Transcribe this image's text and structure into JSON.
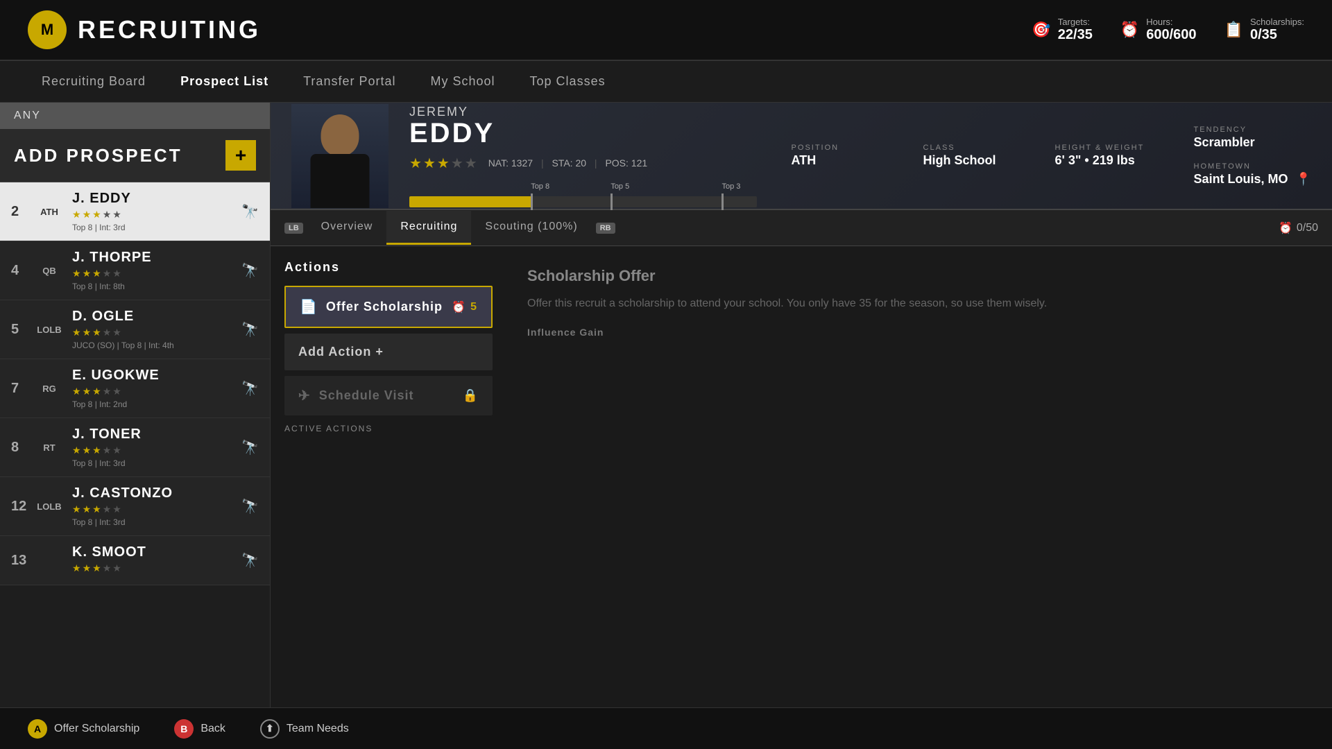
{
  "header": {
    "logo_text": "M",
    "title": "RECRUITING",
    "stats": {
      "targets_label": "Targets:",
      "targets_value": "22/35",
      "hours_label": "Hours:",
      "hours_value": "600/600",
      "scholarships_label": "Scholarships:",
      "scholarships_value": "0/35"
    }
  },
  "nav": {
    "items": [
      {
        "label": "Recruiting Board",
        "id": "recruiting-board",
        "active": false
      },
      {
        "label": "Prospect List",
        "id": "prospect-list",
        "active": true
      },
      {
        "label": "Transfer Portal",
        "id": "transfer-portal",
        "active": false
      },
      {
        "label": "My School",
        "id": "my-school",
        "active": false
      },
      {
        "label": "Top Classes",
        "id": "top-classes",
        "active": false
      }
    ]
  },
  "left_panel": {
    "filter_value": "ANY",
    "add_prospect_label": "ADD PROSPECT",
    "add_plus": "+",
    "prospects": [
      {
        "rank": "2",
        "pos": "ATH",
        "name": "J. EDDY",
        "stars": 3,
        "total_stars": 5,
        "sub": "Top 8 | Int: 3rd",
        "selected": true
      },
      {
        "rank": "4",
        "pos": "QB",
        "name": "J. THORPE",
        "stars": 3,
        "total_stars": 5,
        "sub": "Top 8 | Int: 8th",
        "selected": false
      },
      {
        "rank": "5",
        "pos": "LOLB",
        "name": "D. OGLE",
        "stars": 3,
        "total_stars": 5,
        "sub": "JUCO (SO) | Top 8 | Int: 4th",
        "selected": false
      },
      {
        "rank": "7",
        "pos": "RG",
        "name": "E. UGOKWE",
        "stars": 3,
        "total_stars": 5,
        "sub": "Top 8 | Int: 2nd",
        "selected": false
      },
      {
        "rank": "8",
        "pos": "RT",
        "name": "J. TONER",
        "stars": 3,
        "total_stars": 5,
        "sub": "Top 8 | Int: 3rd",
        "selected": false
      },
      {
        "rank": "12",
        "pos": "LOLB",
        "name": "J. CASTONZO",
        "stars": 3,
        "total_stars": 5,
        "sub": "Top 8 | Int: 3rd",
        "selected": false
      },
      {
        "rank": "13",
        "pos": "",
        "name": "K. SMOOT",
        "stars": 3,
        "total_stars": 5,
        "sub": "",
        "selected": false
      }
    ]
  },
  "player": {
    "first_name": "JEREMY",
    "last_name": "EDDY",
    "stars": 3,
    "total_stars": 5,
    "nat": "1327",
    "sta": "20",
    "pos_rank": "121",
    "position": "ATH",
    "class": "High School",
    "height_weight": "6' 3\" • 219 lbs",
    "tendency": "Scrambler",
    "hometown": "Saint Louis, MO",
    "progress_fill_pct": 35,
    "top8_pct": 35,
    "top5_pct": 58,
    "top3_pct": 90,
    "top8_label": "Top 8",
    "top5_label": "Top 5",
    "top3_label": "Top 3"
  },
  "tabs": {
    "items": [
      {
        "label": "Overview",
        "id": "overview",
        "active": false,
        "badge_left": "LB"
      },
      {
        "label": "Recruiting",
        "id": "recruiting",
        "active": true,
        "badge_left": ""
      },
      {
        "label": "Scouting (100%)",
        "id": "scouting",
        "active": false,
        "badge_right": "RB"
      }
    ],
    "timer": "0/50"
  },
  "actions": {
    "title": "Actions",
    "items": [
      {
        "id": "offer-scholarship",
        "label": "Offer Scholarship",
        "icon": "📜",
        "cost": "5",
        "type": "primary",
        "locked": false
      },
      {
        "id": "add-action",
        "label": "Add Action +",
        "icon": "",
        "cost": "",
        "type": "secondary",
        "locked": false
      },
      {
        "id": "schedule-visit",
        "label": "Schedule Visit",
        "icon": "✈",
        "cost": "",
        "type": "locked",
        "locked": true
      }
    ],
    "active_actions_label": "ACTIVE ACTIONS"
  },
  "scholarship_desc": {
    "title": "Scholarship Offer",
    "text": "Offer this recruit a scholarship to attend your school. You only have 35 for the season, so use them wisely.",
    "influence_label": "Influence Gain"
  },
  "bottom_bar": {
    "actions": [
      {
        "badge_type": "yellow",
        "badge_text": "A",
        "label": "Offer Scholarship"
      },
      {
        "badge_type": "red",
        "badge_text": "B",
        "label": "Back"
      },
      {
        "badge_type": "outline",
        "badge_text": "⬆",
        "label": "Team Needs"
      }
    ]
  },
  "position_label": "POSITION",
  "class_label": "CLASS",
  "hw_label": "HEIGHT & WEIGHT",
  "tendency_label": "TENDENCY",
  "hometown_label": "HOMETOWN",
  "nat_label": "NAT:",
  "sta_label": "STA:",
  "pos_label": "POS:"
}
